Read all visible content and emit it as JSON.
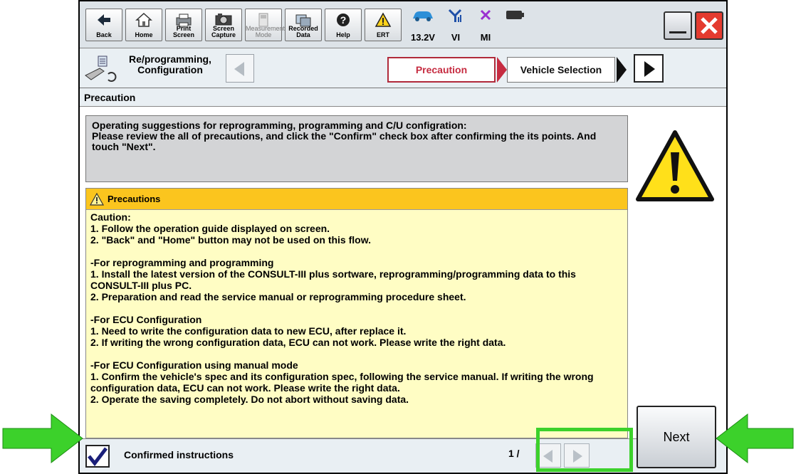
{
  "toolbar": {
    "buttons": [
      {
        "id": "back",
        "label": "Back"
      },
      {
        "id": "home",
        "label": "Home"
      },
      {
        "id": "print",
        "label": "Print Screen"
      },
      {
        "id": "capture",
        "label": "Screen Capture"
      },
      {
        "id": "measure",
        "label": "Measurement Mode"
      },
      {
        "id": "recorded",
        "label": "Recorded Data"
      },
      {
        "id": "help",
        "label": "Help"
      },
      {
        "id": "ert",
        "label": "ERT"
      }
    ],
    "status": {
      "voltage": "13.2V",
      "vi": "VI",
      "mi": "MI"
    }
  },
  "nav": {
    "mode_title": "Re/programming, Configuration",
    "step_current": "Precaution",
    "step_next": "Vehicle Selection"
  },
  "section_title": "Precaution",
  "info_text": "Operating suggestions for reprogramming, programming and C/U configration:\nPlease review the all of precautions, and click the \"Confirm\" check box after confirming the its points. And touch \"Next\".",
  "precautions": {
    "header": "Precautions",
    "body": "Caution:\n1. Follow the operation guide displayed on screen.\n2. \"Back\" and \"Home\" button may not be used on this flow.\n\n-For reprogramming and programming\n1. Install the latest version of the CONSULT-III plus sortware, reprogramming/programming data to this CONSULT-III plus PC.\n2. Preparation and read the service manual or reprogramming procedure sheet.\n\n-For ECU Configuration\n1. Need to write the configuration data to new ECU, after replace it.\n2. If writing the wrong configuration data, ECU can not work. Please write the right data.\n\n-For ECU Configuration using manual mode\n1. Confirm the vehicle's spec and its configuration spec, following the service manual.  If writing the wrong configuration data, ECU can not work. Please write the right data.\n2. Operate the saving completely. Do not abort without saving data."
  },
  "bottom": {
    "confirm_label": "Confirmed instructions",
    "confirmed": true,
    "page": "1 /"
  },
  "next_label": "Next",
  "colors": {
    "highlight": "#3cd12b",
    "step_active": "#c62c41",
    "precaution_header": "#fbc51e",
    "precaution_bg": "#fffdc4"
  }
}
